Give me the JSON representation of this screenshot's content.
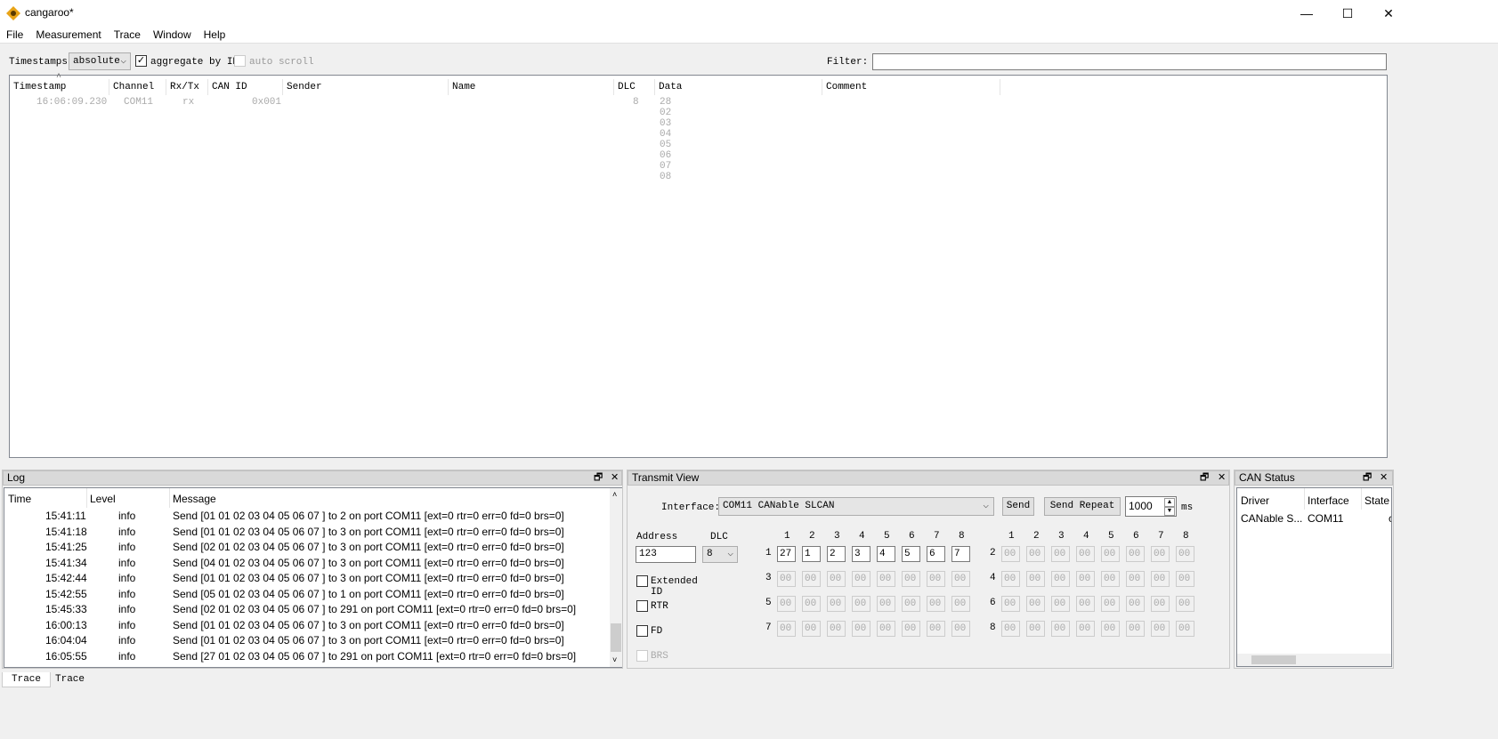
{
  "window": {
    "title": "cangaroo*",
    "minimize": "—",
    "maximize": "☐",
    "close": "✕"
  },
  "menu": [
    "File",
    "Measurement",
    "Trace",
    "Window",
    "Help"
  ],
  "toolbar": {
    "timestamps_label": "Timestamps:",
    "timestamps_value": "absolute",
    "aggregate_label": "aggregate by ID",
    "aggregate_checked": true,
    "autoscroll_label": "auto scroll",
    "autoscroll_checked": false,
    "filter_label": "Filter:",
    "filter_value": ""
  },
  "trace": {
    "columns": [
      "Timestamp",
      "Channel",
      "Rx/Tx",
      "CAN ID",
      "Sender",
      "Name",
      "DLC",
      "Data",
      "Comment"
    ],
    "rows": [
      {
        "timestamp": "16:06:09.230",
        "channel": "COM11",
        "rxtx": "rx",
        "can_id": "0x001",
        "sender": "",
        "name": "",
        "dlc": "8",
        "data": "28 02 03 04 05 06 07 08",
        "comment": ""
      }
    ]
  },
  "log": {
    "title": "Log",
    "columns": [
      "Time",
      "Level",
      "Message"
    ],
    "rows": [
      {
        "time": "15:41:11",
        "level": "info",
        "message": "Send [01 01 02 03 04 05 06 07 ] to 2 on port COM11 [ext=0 rtr=0 err=0 fd=0 brs=0]"
      },
      {
        "time": "15:41:18",
        "level": "info",
        "message": "Send [01 01 02 03 04 05 06 07 ] to 3 on port COM11 [ext=0 rtr=0 err=0 fd=0 brs=0]"
      },
      {
        "time": "15:41:25",
        "level": "info",
        "message": "Send [02 01 02 03 04 05 06 07 ] to 3 on port COM11 [ext=0 rtr=0 err=0 fd=0 brs=0]"
      },
      {
        "time": "15:41:34",
        "level": "info",
        "message": "Send [04 01 02 03 04 05 06 07 ] to 3 on port COM11 [ext=0 rtr=0 err=0 fd=0 brs=0]"
      },
      {
        "time": "15:42:44",
        "level": "info",
        "message": "Send [01 01 02 03 04 05 06 07 ] to 3 on port COM11 [ext=0 rtr=0 err=0 fd=0 brs=0]"
      },
      {
        "time": "15:42:55",
        "level": "info",
        "message": "Send [05 01 02 03 04 05 06 07 ] to 1 on port COM11 [ext=0 rtr=0 err=0 fd=0 brs=0]"
      },
      {
        "time": "15:45:33",
        "level": "info",
        "message": "Send [02 01 02 03 04 05 06 07 ] to 291 on port COM11 [ext=0 rtr=0 err=0 fd=0 brs=0]"
      },
      {
        "time": "16:00:13",
        "level": "info",
        "message": "Send [01 01 02 03 04 05 06 07 ] to 3 on port COM11 [ext=0 rtr=0 err=0 fd=0 brs=0]"
      },
      {
        "time": "16:04:04",
        "level": "info",
        "message": "Send [01 01 02 03 04 05 06 07 ] to 3 on port COM11 [ext=0 rtr=0 err=0 fd=0 brs=0]"
      },
      {
        "time": "16:05:55",
        "level": "info",
        "message": "Send [27 01 02 03 04 05 06 07 ] to 291 on port COM11 [ext=0 rtr=0 err=0 fd=0 brs=0]"
      }
    ]
  },
  "transmit": {
    "title": "Transmit View",
    "interface_label": "Interface:",
    "interface_value": "COM11 CANable SLCAN",
    "send": "Send",
    "send_repeat": "Send Repeat",
    "repeat_value": "1000",
    "ms": "ms",
    "address_label": "Address",
    "address_value": "123",
    "dlc_label": "DLC",
    "dlc_value": "8",
    "extended_id": "Extended ID",
    "rtr": "RTR",
    "fd": "FD",
    "brs": "BRS",
    "byte_headers": [
      "1",
      "2",
      "3",
      "4",
      "5",
      "6",
      "7",
      "8"
    ],
    "row_labels": [
      "1",
      "2",
      "3",
      "4",
      "5",
      "6",
      "7",
      "8"
    ],
    "row1_values": [
      "27",
      "1",
      "2",
      "3",
      "4",
      "5",
      "6",
      "7"
    ],
    "placeholder": "00"
  },
  "can_status": {
    "title": "CAN Status",
    "columns": [
      "Driver",
      "Interface",
      "State"
    ],
    "rows": [
      {
        "driver": "CANable S...",
        "interface": "COM11",
        "state": "c"
      }
    ]
  },
  "bottom_tabs": [
    "Trace",
    "Trace"
  ]
}
